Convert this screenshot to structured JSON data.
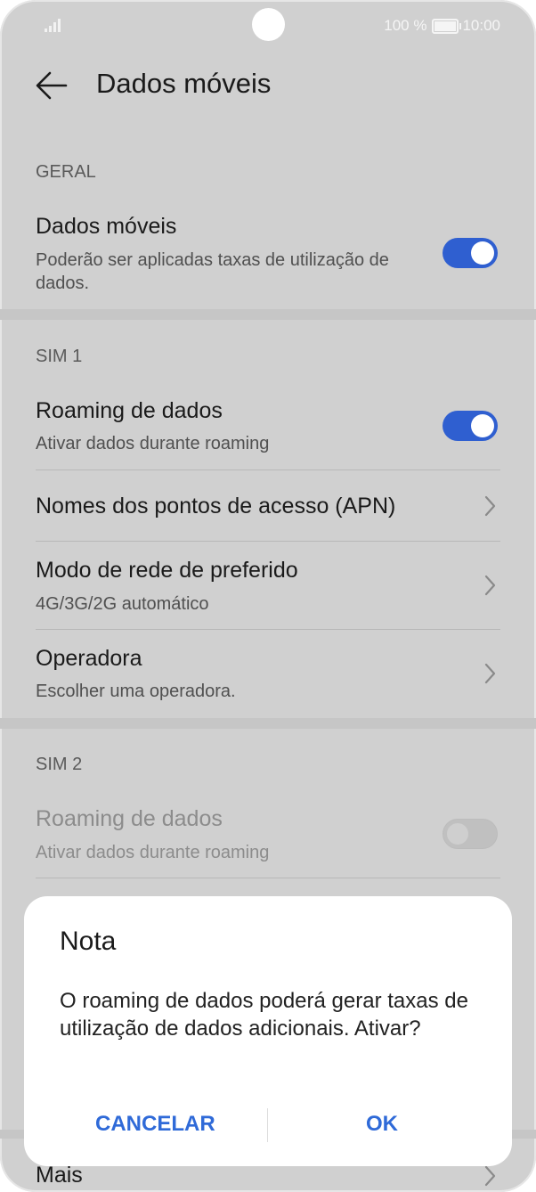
{
  "status_bar": {
    "battery_text": "100 %",
    "time": "10:00"
  },
  "header": {
    "title": "Dados móveis"
  },
  "sections": {
    "geral": {
      "label": "GERAL",
      "mobile_data": {
        "title": "Dados móveis",
        "subtitle": "Poderão ser aplicadas taxas de utilização de dados.",
        "enabled": true
      }
    },
    "sim1": {
      "label": "SIM 1",
      "roaming": {
        "title": "Roaming de dados",
        "subtitle": "Ativar dados durante roaming",
        "enabled": true
      },
      "apn": {
        "title": "Nomes dos pontos de acesso (APN)"
      },
      "network_mode": {
        "title": "Modo de rede de preferido",
        "subtitle": "4G/3G/2G automático"
      },
      "operator": {
        "title": "Operadora",
        "subtitle": "Escolher uma operadora."
      }
    },
    "sim2": {
      "label": "SIM 2",
      "roaming": {
        "title": "Roaming de dados",
        "subtitle": "Ativar dados durante roaming",
        "enabled": false
      }
    },
    "more": {
      "title": "Mais"
    }
  },
  "dialog": {
    "title": "Nota",
    "message": "O roaming de dados poderá gerar taxas de utilização de dados adicionais. Ativar?",
    "cancel_label": "CANCELAR",
    "ok_label": "OK"
  },
  "colors": {
    "accent": "#2f5fd0",
    "dialog_button": "#2f6ad8",
    "overlay": "#d0d0d0"
  }
}
